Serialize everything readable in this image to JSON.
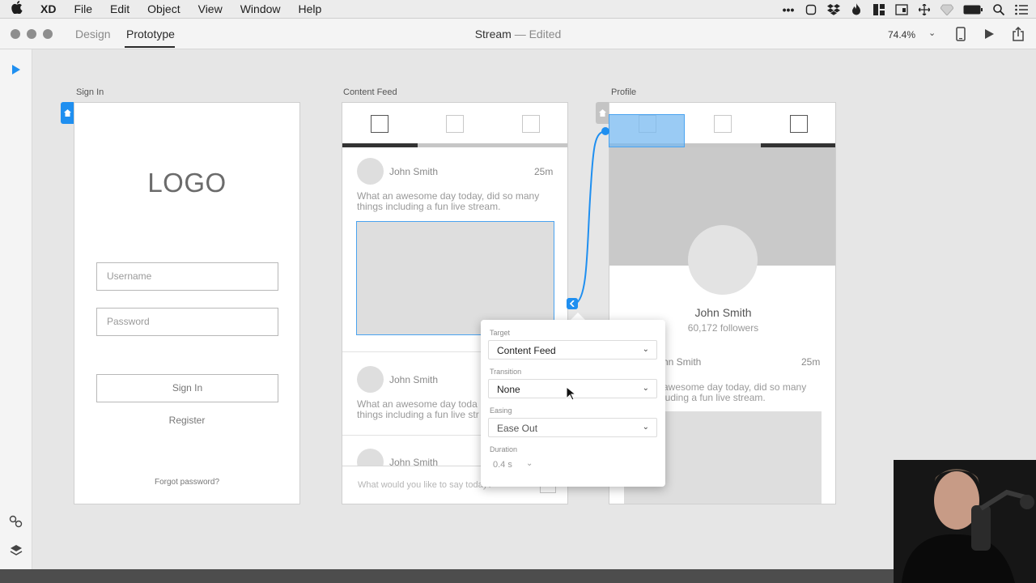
{
  "menubar": {
    "app": "XD",
    "items": [
      "File",
      "Edit",
      "Object",
      "View",
      "Window",
      "Help"
    ],
    "battery": "",
    "icons": [
      "ellipsis-icon",
      "display-icon",
      "dropbox-icon",
      "flame-icon",
      "grid-icon",
      "calendar-icon",
      "move-icon",
      "diamond-icon",
      "battery-icon",
      "search-icon",
      "list-icon"
    ]
  },
  "titlebar": {
    "tabs": [
      "Design",
      "Prototype"
    ],
    "active_tab": "Prototype",
    "doc_name": "Stream",
    "doc_status": " — Edited",
    "zoom": "74.4%"
  },
  "artboards": {
    "signin": {
      "label": "Sign In",
      "logo": "LOGO",
      "username_placeholder": "Username",
      "password_placeholder": "Password",
      "signin_button": "Sign In",
      "register": "Register",
      "forgot": "Forgot password?"
    },
    "feed": {
      "label": "Content Feed",
      "posts": [
        {
          "user": "John Smith",
          "time": "25m",
          "text1": "What an awesome day today, did so many",
          "text2": "things including a fun live stream."
        },
        {
          "user": "John Smith",
          "text1": "What an awesome day toda",
          "text2": "things including a fun live str"
        },
        {
          "user": "John Smith"
        }
      ],
      "compose_placeholder": "What would you like to say today?"
    },
    "profile": {
      "label": "Profile",
      "name": "John Smith",
      "followers": "60,172 followers",
      "post_user": "hn Smith",
      "post_time": "25m",
      "text1": "awesome day today, did so many",
      "text2": "luding a fun live stream."
    }
  },
  "popover": {
    "target_label": "Target",
    "target_value": "Content Feed",
    "transition_label": "Transition",
    "transition_value": "None",
    "easing_label": "Easing",
    "easing_value": "Ease Out",
    "duration_label": "Duration",
    "duration_value": "0.4 s"
  },
  "colors": {
    "accent": "#1f8ff0",
    "selection_fill": "#a9d2f5"
  }
}
